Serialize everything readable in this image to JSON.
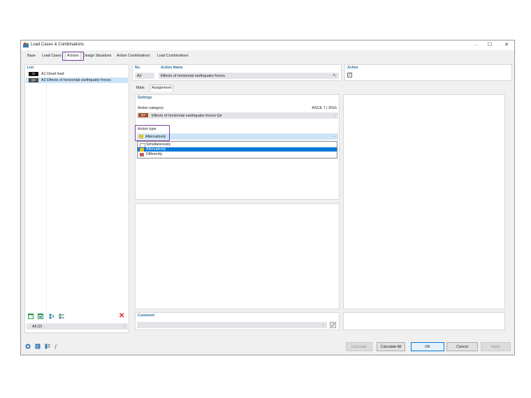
{
  "window": {
    "title": "Load Cases & Combinations",
    "controls": {
      "minimize": "—",
      "maximize": "☐",
      "close": "✕"
    }
  },
  "tabs": [
    "Base",
    "Load Cases",
    "Actions",
    "Design Situations",
    "Action Combinations",
    "Load Combinations"
  ],
  "active_tab": "Actions",
  "list": {
    "header": "List",
    "items": [
      {
        "badge": "D",
        "badge_color": "#111111",
        "label": "A1 Dead load"
      },
      {
        "badge": "Qe",
        "badge_color": "#4a4a4a",
        "label": "A2 Effects of horizontal earthquake forces"
      }
    ],
    "filter": "All (2)"
  },
  "header_fields": {
    "no_label": "No.",
    "no_value": "A2",
    "name_label": "Action Name",
    "name_value": "Effects of horizontal earthquake forces",
    "active_label": "Active",
    "active_checked": "✓"
  },
  "subtabs": [
    "Main",
    "Assignment"
  ],
  "settings": {
    "header": "Settings",
    "category_label": "Action category",
    "category_standard": "ASCE 7 | 2016",
    "category_badge": "Qe",
    "category_badge_color": "#a0522d",
    "category_value": "Effects of horizontal earthquake forces  Qe",
    "type_label": "Action type",
    "type_value": "Alternatively",
    "type_swatch": "#e8c020"
  },
  "dropdown": {
    "options": [
      {
        "label": "Simultaneously",
        "color": "#ffffff"
      },
      {
        "label": "Alternatively",
        "color": "#e8c020"
      },
      {
        "label": "Differently",
        "color": "#c0605a"
      }
    ]
  },
  "comment": {
    "label": "Comment"
  },
  "buttons": {
    "calculate": "Calculate",
    "calculate_all": "Calculate All",
    "ok": "OK",
    "cancel": "Cancel",
    "apply": "Apply"
  },
  "colors": {
    "accent": "#2f6f99",
    "highlight": "#7a3fa0",
    "selection": "#0078d7"
  }
}
